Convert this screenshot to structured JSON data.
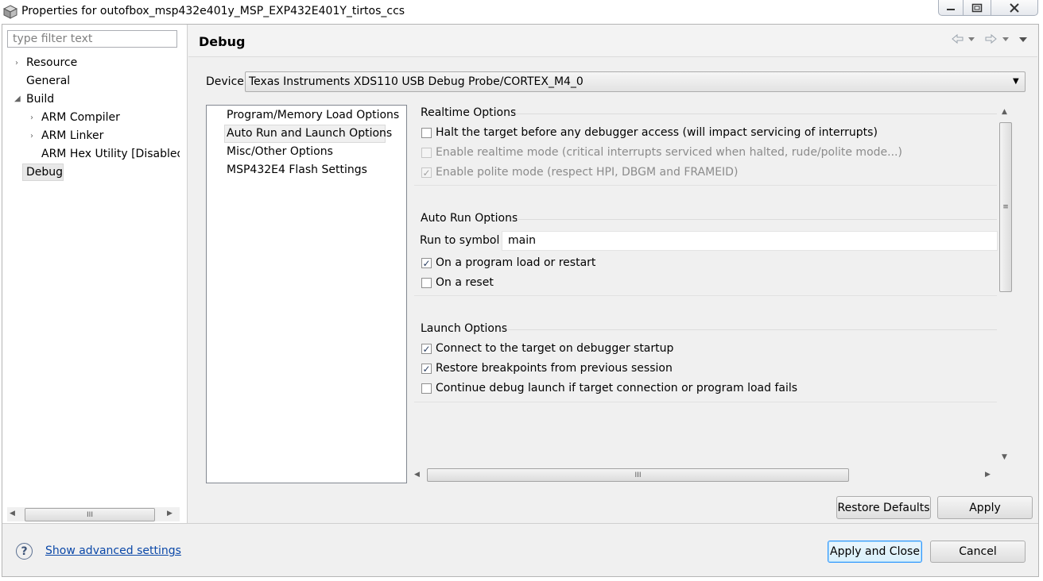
{
  "window": {
    "title": "Properties for outofbox_msp432e401y_MSP_EXP432E401Y_tirtos_ccs"
  },
  "left_panel": {
    "filter_placeholder": "type filter text",
    "tree": [
      {
        "label": "Resource"
      },
      {
        "label": "General"
      },
      {
        "label": "Build"
      },
      {
        "label": "ARM Compiler"
      },
      {
        "label": "ARM Linker"
      },
      {
        "label": "ARM Hex Utility  [Disabled]"
      },
      {
        "label": "Debug"
      }
    ]
  },
  "page": {
    "title": "Debug",
    "device_label": "Device",
    "device_value": "Texas Instruments XDS110 USB Debug Probe/CORTEX_M4_0"
  },
  "option_list": [
    "Program/Memory Load Options",
    "Auto Run and Launch Options",
    "Misc/Other Options",
    "MSP432E4 Flash Settings"
  ],
  "groups": {
    "realtime": {
      "title": "Realtime Options",
      "items": [
        {
          "label": "Halt the target before any debugger access (will impact servicing of interrupts)",
          "checked": false,
          "enabled": true
        },
        {
          "label": "Enable realtime mode (critical interrupts serviced when halted, rude/polite mode...)",
          "checked": false,
          "enabled": false
        },
        {
          "label": "Enable polite mode (respect HPI, DBGM and FRAMEID)",
          "checked": true,
          "enabled": false
        }
      ]
    },
    "autorun": {
      "title": "Auto Run Options",
      "run_to_label": "Run to symbol",
      "run_to_value": "main",
      "items": [
        {
          "label": "On a program load or restart",
          "checked": true
        },
        {
          "label": "On a reset",
          "checked": false
        }
      ]
    },
    "launch": {
      "title": "Launch Options",
      "items": [
        {
          "label": "Connect to the target on debugger startup",
          "checked": true
        },
        {
          "label": "Restore breakpoints from previous session",
          "checked": true
        },
        {
          "label": "Continue debug launch if target connection or program load fails",
          "checked": false
        }
      ]
    }
  },
  "buttons": {
    "restore_defaults": "Restore Defaults",
    "apply": "Apply",
    "apply_and_close": "Apply and Close",
    "cancel": "Cancel"
  },
  "footer": {
    "advanced_link": "Show advanced settings"
  },
  "glyphs": {
    "scroll_grip_h": "III",
    "scroll_grip_v": "≡",
    "check": "✓",
    "help": "?"
  }
}
